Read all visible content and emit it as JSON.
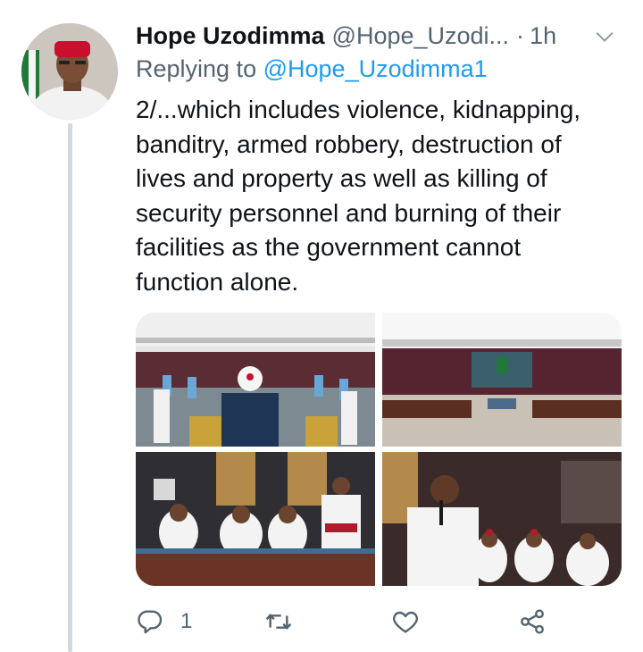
{
  "tweet": {
    "author_name": "Hope Uzodimma",
    "author_handle": "@Hope_Uzodi...",
    "separator": "·",
    "time": "1h",
    "reply_prefix": "Replying to",
    "reply_handle": "@Hope_Uzodimma1",
    "text": "2/...which includes violence, kidnapping,\nbanditry, armed robbery, destruction of\nlives and property as well as killing of\nsecurity personnel and burning of their\nfacilities as the government cannot\nfunction alone.",
    "media_count": 4
  },
  "actions": {
    "reply_count": "1",
    "retweet_count": "",
    "like_count": ""
  },
  "icons": {
    "more": "chevron-down-icon",
    "reply": "reply-icon",
    "retweet": "retweet-icon",
    "like": "heart-icon",
    "share": "share-icon"
  },
  "colors": {
    "text": "#0f1419",
    "muted": "#536471",
    "link": "#1d9bf0",
    "thread_line": "#cfd9de"
  }
}
